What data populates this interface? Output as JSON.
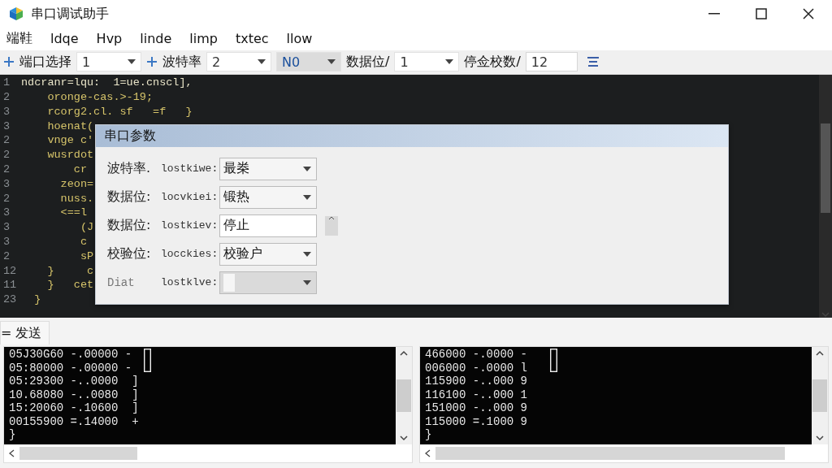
{
  "window": {
    "title": "串口调试助手"
  },
  "menu": [
    "端鞋",
    "ldqe",
    "Hvp",
    "linde",
    "limp",
    "txtec",
    "llow"
  ],
  "toolbar": [
    {
      "kind": "plus"
    },
    {
      "kind": "label",
      "text": "端口选择"
    },
    {
      "kind": "select",
      "value": "1",
      "disabled": false
    },
    {
      "kind": "plus"
    },
    {
      "kind": "label",
      "text": "波特率"
    },
    {
      "kind": "select",
      "value": "2",
      "disabled": false
    },
    {
      "kind": "select",
      "value": "N0",
      "disabled": true
    },
    {
      "kind": "label",
      "text": "数据位/"
    },
    {
      "kind": "select",
      "value": "1",
      "disabled": false
    },
    {
      "kind": "label",
      "text": "停佥校数/"
    },
    {
      "kind": "input",
      "value": "12"
    },
    {
      "kind": "menu"
    }
  ],
  "editor": {
    "lines": [
      {
        "number": "1",
        "text": "ndcranr=lqu:  1=ue.cnscl],"
      },
      {
        "number": "2",
        "text": "    oronge-cas.>-19;"
      },
      {
        "number": "3",
        "text": "    rcorg2.cl. sf   =f   }"
      },
      {
        "number": "3",
        "text": "    hoenat("
      },
      {
        "number": "2",
        "text": "    vnge c'"
      },
      {
        "number": "2",
        "text": "    wusrdot"
      },
      {
        "number": "2",
        "text": "        cr"
      },
      {
        "number": "3",
        "text": "      zeon="
      },
      {
        "number": "2",
        "text": "      nuss."
      },
      {
        "number": "3",
        "text": "      <==l"
      },
      {
        "number": "3",
        "text": "         (J"
      },
      {
        "number": "3",
        "text": "         c"
      },
      {
        "number": "2",
        "text": "         sP"
      },
      {
        "number": "12",
        "text": "    }     c"
      },
      {
        "number": "11",
        "text": "    }   cet"
      },
      {
        "number": "23",
        "text": "  }"
      }
    ]
  },
  "dialog": {
    "title": "串口参数",
    "rows": [
      {
        "label": "波特率.",
        "sublabel": "lostkiwe:",
        "kind": "select",
        "value": "最桊",
        "disabled": false
      },
      {
        "label": "数据位:",
        "sublabel": "locvkiei:",
        "kind": "select",
        "value": "锻热",
        "disabled": false
      },
      {
        "label": "数据位:",
        "sublabel": "lostkiev:",
        "kind": "input",
        "value": "停止",
        "disabled": false
      },
      {
        "label": "校验位:",
        "sublabel": "locckies:",
        "kind": "select",
        "value": "校验户",
        "disabled": false
      },
      {
        "label": "Diat",
        "sublabel": "lostklve:",
        "kind": "select",
        "disabled": true
      }
    ]
  },
  "send_tab": {
    "label": "= 发送"
  },
  "terminals": [
    {
      "lines": [
        "05J30G60 -.00000 -",
        "05:80000 -.00000 -",
        "05:29300 -..0000  ]",
        "10.68080 -..0080  ]",
        "15:20060 -.10600  ]",
        "00155900 =.14000  +",
        "}"
      ]
    },
    {
      "lines": [
        "466000 -.0000 -",
        "006000 -.0000 l",
        "115900 -..000 9",
        "116100 -..000 1",
        "151000 -..000 9",
        "115000 =.1000 9",
        "}"
      ]
    }
  ]
}
